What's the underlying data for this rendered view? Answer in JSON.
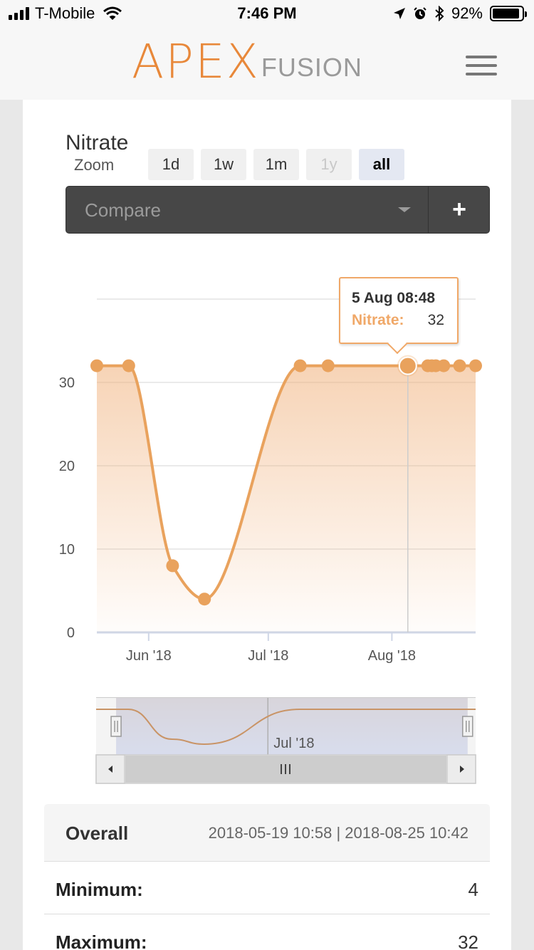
{
  "status_bar": {
    "carrier": "T-Mobile",
    "time": "7:46 PM",
    "battery": "92%",
    "battery_level": 0.92,
    "icons": [
      "signal-icon",
      "wifi-icon",
      "location-icon",
      "alarm-icon",
      "bluetooth-icon",
      "battery-icon"
    ]
  },
  "header": {
    "logo_main": "APEX",
    "logo_sub": "FUSION",
    "menu_icon": "hamburger-menu-icon"
  },
  "page": {
    "title": "Nitrate"
  },
  "compare": {
    "placeholder": "Compare",
    "add_label": "+"
  },
  "zoom": {
    "label": "Zoom",
    "options": [
      {
        "label": "1d",
        "state": "normal"
      },
      {
        "label": "1w",
        "state": "normal"
      },
      {
        "label": "1m",
        "state": "normal"
      },
      {
        "label": "1y",
        "state": "disabled"
      },
      {
        "label": "all",
        "state": "active"
      }
    ]
  },
  "tooltip": {
    "date": "5 Aug 08:48",
    "series": "Nitrate:",
    "value": "32"
  },
  "colors": {
    "accent": "#e8883a",
    "series": "#f0a868",
    "navigator": "#d0d8ec"
  },
  "chart_data": {
    "type": "area",
    "series": [
      {
        "name": "Nitrate",
        "points": [
          {
            "x": "2018-05-19",
            "y": 32
          },
          {
            "x": "2018-05-27",
            "y": 32
          },
          {
            "x": "2018-06-07",
            "y": 8
          },
          {
            "x": "2018-06-15",
            "y": 4
          },
          {
            "x": "2018-07-09",
            "y": 32
          },
          {
            "x": "2018-07-16",
            "y": 32
          },
          {
            "x": "2018-08-05",
            "y": 32
          },
          {
            "x": "2018-08-10",
            "y": 32
          },
          {
            "x": "2018-08-11",
            "y": 32
          },
          {
            "x": "2018-08-12",
            "y": 32
          },
          {
            "x": "2018-08-14",
            "y": 32
          },
          {
            "x": "2018-08-18",
            "y": 32
          },
          {
            "x": "2018-08-22",
            "y": 32
          }
        ]
      }
    ],
    "x_ticks": [
      {
        "date": "2018-06-01",
        "label": "Jun '18"
      },
      {
        "date": "2018-07-01",
        "label": "Jul '18"
      },
      {
        "date": "2018-08-01",
        "label": "Aug '18"
      }
    ],
    "yticks": [
      0,
      10,
      20,
      30
    ],
    "ylim": [
      0,
      40
    ],
    "xlim": [
      "2018-05-19",
      "2018-08-22"
    ],
    "highlighted_point": "2018-08-05",
    "grid": true,
    "navigator": {
      "range": [
        "2018-05-24",
        "2018-08-20"
      ],
      "label": "Jul '18",
      "label_date": "2018-07-01"
    }
  },
  "stats": {
    "title": "Overall",
    "range": "2018-05-19 10:58 | 2018-08-25 10:42",
    "rows": [
      {
        "label": "Minimum:",
        "value": "4"
      },
      {
        "label": "Maximum:",
        "value": "32"
      }
    ]
  }
}
